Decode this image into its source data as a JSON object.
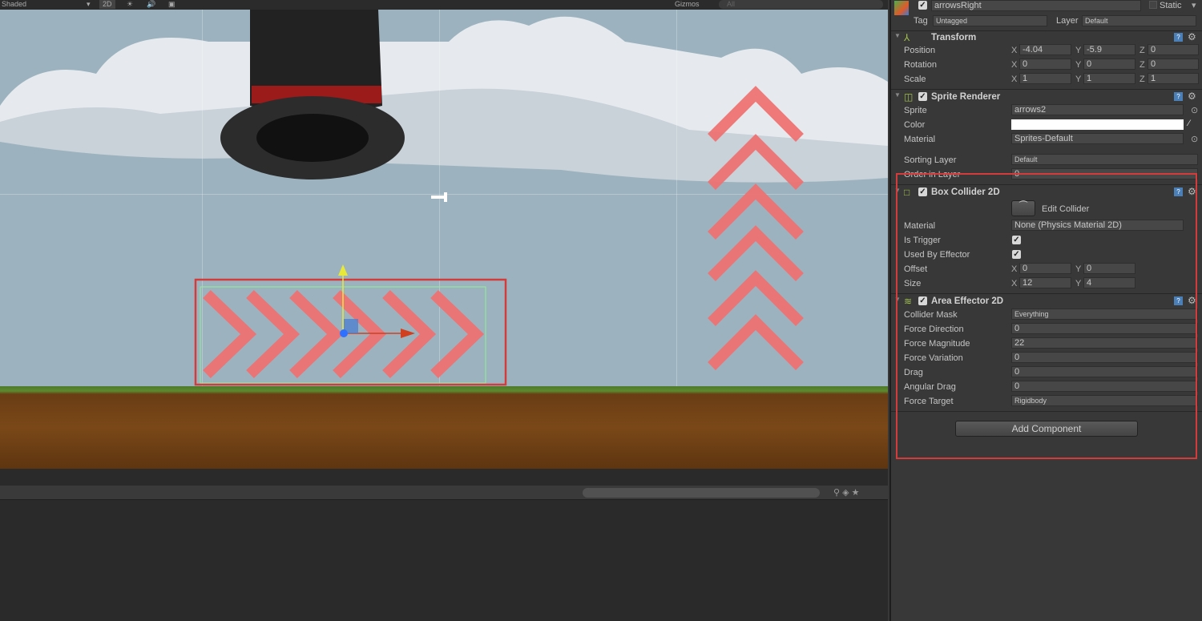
{
  "scene_toolbar": {
    "shading": "Shaded",
    "mode_2d": "2D",
    "gizmos": "Gizmos",
    "search_placeholder": "All"
  },
  "inspector": {
    "object_name": "arrowsRight",
    "static_label": "Static",
    "tag_label": "Tag",
    "tag_value": "Untagged",
    "layer_label": "Layer",
    "layer_value": "Default",
    "transform": {
      "title": "Transform",
      "position": {
        "label": "Position",
        "x": "-4.04",
        "y": "-5.9",
        "z": "0"
      },
      "rotation": {
        "label": "Rotation",
        "x": "0",
        "y": "0",
        "z": "0"
      },
      "scale": {
        "label": "Scale",
        "x": "1",
        "y": "1",
        "z": "1"
      }
    },
    "sprite_renderer": {
      "title": "Sprite Renderer",
      "sprite_label": "Sprite",
      "sprite_value": "arrows2",
      "color_label": "Color",
      "color_value": "#ffffff",
      "material_label": "Material",
      "material_value": "Sprites-Default",
      "sorting_layer_label": "Sorting Layer",
      "sorting_layer_value": "Default",
      "order_label": "Order in Layer",
      "order_value": "0"
    },
    "box_collider": {
      "title": "Box Collider 2D",
      "edit_collider": "Edit Collider",
      "material_label": "Material",
      "material_value": "None (Physics Material 2D)",
      "is_trigger_label": "Is Trigger",
      "is_trigger": true,
      "used_by_effector_label": "Used By Effector",
      "used_by_effector": true,
      "offset": {
        "label": "Offset",
        "x": "0",
        "y": "0"
      },
      "size": {
        "label": "Size",
        "x": "12",
        "y": "4"
      }
    },
    "area_effector": {
      "title": "Area Effector 2D",
      "collider_mask_label": "Collider Mask",
      "collider_mask_value": "Everything",
      "force_direction_label": "Force Direction",
      "force_direction": "0",
      "force_magnitude_label": "Force Magnitude",
      "force_magnitude": "22",
      "force_variation_label": "Force Variation",
      "force_variation": "0",
      "drag_label": "Drag",
      "drag": "0",
      "angular_drag_label": "Angular Drag",
      "angular_drag": "0",
      "force_target_label": "Force Target",
      "force_target_value": "Rigidbody"
    },
    "add_component": "Add Component",
    "axes": {
      "x": "X",
      "y": "Y",
      "z": "Z"
    }
  },
  "colors": {
    "highlight": "#d43c3c",
    "arrows": "#f07070",
    "sky": "#9cb3bf"
  }
}
